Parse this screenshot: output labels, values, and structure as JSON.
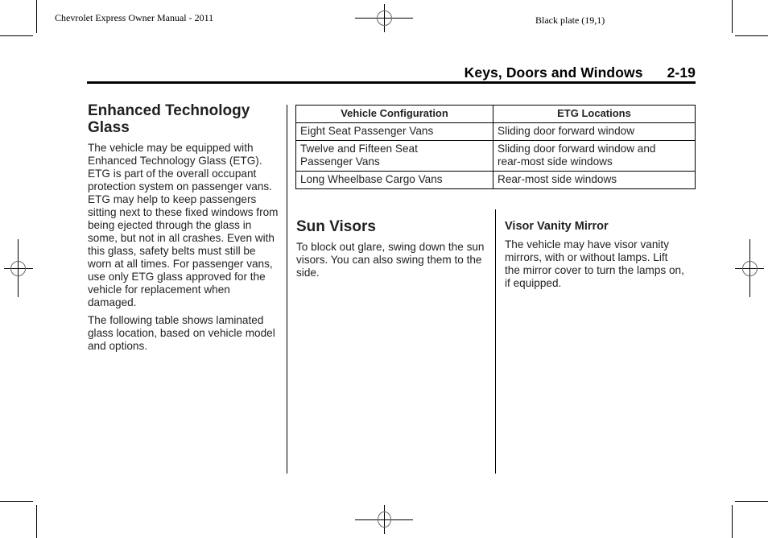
{
  "slug": {
    "left": "Chevrolet Express Owner Manual - 2011",
    "right": "Black plate (19,1)"
  },
  "running_head": {
    "section": "Keys, Doors and Windows",
    "page": "2-19"
  },
  "etg_section": {
    "title": "Enhanced Technology Glass",
    "paragraphs": [
      "The vehicle may be equipped with Enhanced Technology Glass (ETG). ETG is part of the overall occupant protection system on passenger vans. ETG may help to keep passengers sitting next to these fixed windows from being ejected through the glass in some, but not in all crashes. Even with this glass, safety belts must still be worn at all times. For passenger vans, use only ETG glass approved for the vehicle for replacement when damaged.",
      "The following table shows laminated glass location, based on vehicle model and options."
    ]
  },
  "etg_table": {
    "headers": [
      "Vehicle Configuration",
      "ETG Locations"
    ],
    "rows": [
      [
        "Eight Seat Passenger Vans",
        "Sliding door forward window"
      ],
      [
        "Twelve and Fifteen Seat Passenger Vans",
        "Sliding door forward window and rear-most side windows"
      ],
      [
        "Long Wheelbase Cargo Vans",
        "Rear-most side windows"
      ]
    ]
  },
  "sun_visors": {
    "title": "Sun Visors",
    "paragraph": "To block out glare, swing down the sun visors. You can also swing them to the side."
  },
  "visor_mirror": {
    "title": "Visor Vanity Mirror",
    "paragraph": "The vehicle may have visor vanity mirrors, with or without lamps. Lift the mirror cover to turn the lamps on, if equipped."
  }
}
